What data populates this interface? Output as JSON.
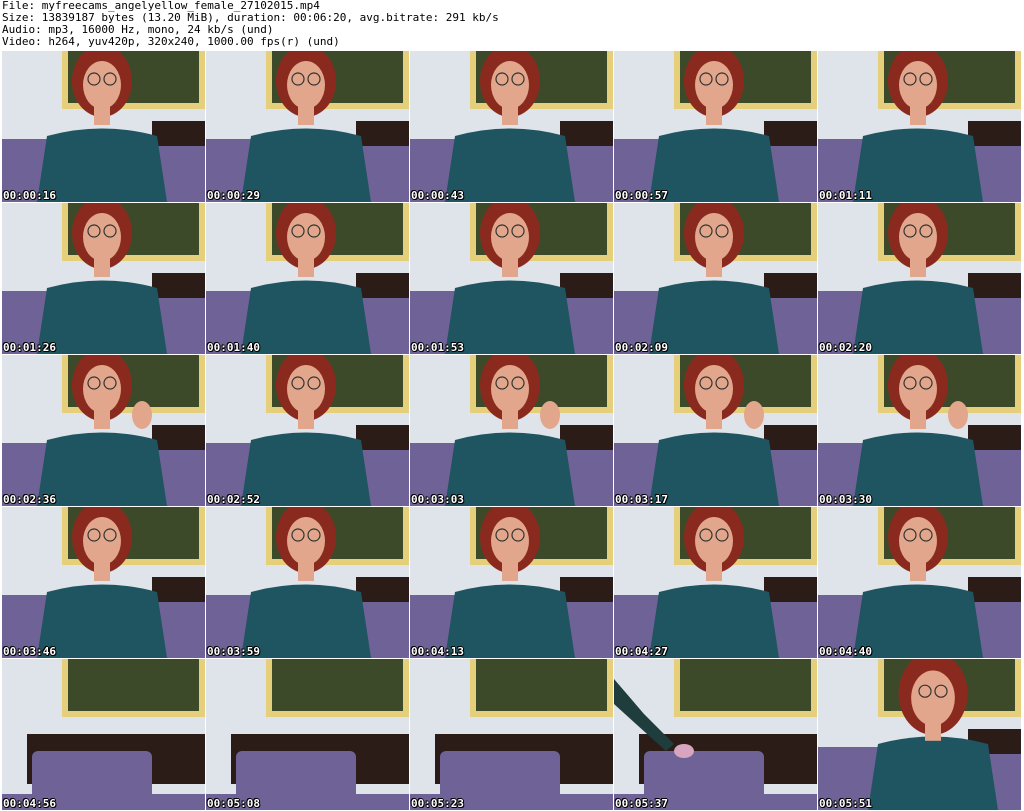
{
  "header": {
    "file": "File: myfreecams_angelyellow_female_27102015.mp4",
    "size": "Size: 13839187 bytes (13.20 MiB), duration: 00:06:20, avg.bitrate: 291 kb/s",
    "audio": "Audio: mp3, 16000 Hz, mono, 24 kb/s (und)",
    "video": "Video: h264, yuv420p, 320x240, 1000.00 fps(r) (und)"
  },
  "frames": [
    {
      "time": "00:00:16",
      "scene": "person"
    },
    {
      "time": "00:00:29",
      "scene": "person"
    },
    {
      "time": "00:00:43",
      "scene": "person"
    },
    {
      "time": "00:00:57",
      "scene": "person"
    },
    {
      "time": "00:01:11",
      "scene": "person"
    },
    {
      "time": "00:01:26",
      "scene": "person"
    },
    {
      "time": "00:01:40",
      "scene": "person"
    },
    {
      "time": "00:01:53",
      "scene": "person"
    },
    {
      "time": "00:02:09",
      "scene": "person"
    },
    {
      "time": "00:02:20",
      "scene": "person"
    },
    {
      "time": "00:02:36",
      "scene": "person"
    },
    {
      "time": "00:02:52",
      "scene": "person"
    },
    {
      "time": "00:03:03",
      "scene": "person"
    },
    {
      "time": "00:03:17",
      "scene": "person"
    },
    {
      "time": "00:03:30",
      "scene": "person"
    },
    {
      "time": "00:03:46",
      "scene": "person"
    },
    {
      "time": "00:03:59",
      "scene": "person"
    },
    {
      "time": "00:04:13",
      "scene": "person"
    },
    {
      "time": "00:04:27",
      "scene": "person"
    },
    {
      "time": "00:04:40",
      "scene": "person"
    },
    {
      "time": "00:04:56",
      "scene": "empty-bed"
    },
    {
      "time": "00:05:08",
      "scene": "empty-bed"
    },
    {
      "time": "00:05:23",
      "scene": "empty-bed"
    },
    {
      "time": "00:05:37",
      "scene": "empty-bed-arm"
    },
    {
      "time": "00:05:51",
      "scene": "person-close"
    }
  ],
  "colors": {
    "wall": "#dfe3ea",
    "hair": "#8a2a1e",
    "skin": "#e2a68c",
    "shirt": "#1f5560",
    "pillow": "#6e6296",
    "headboard": "#2b1c18",
    "painting": "#3d4a2a",
    "frame": "#e6cf7a"
  }
}
